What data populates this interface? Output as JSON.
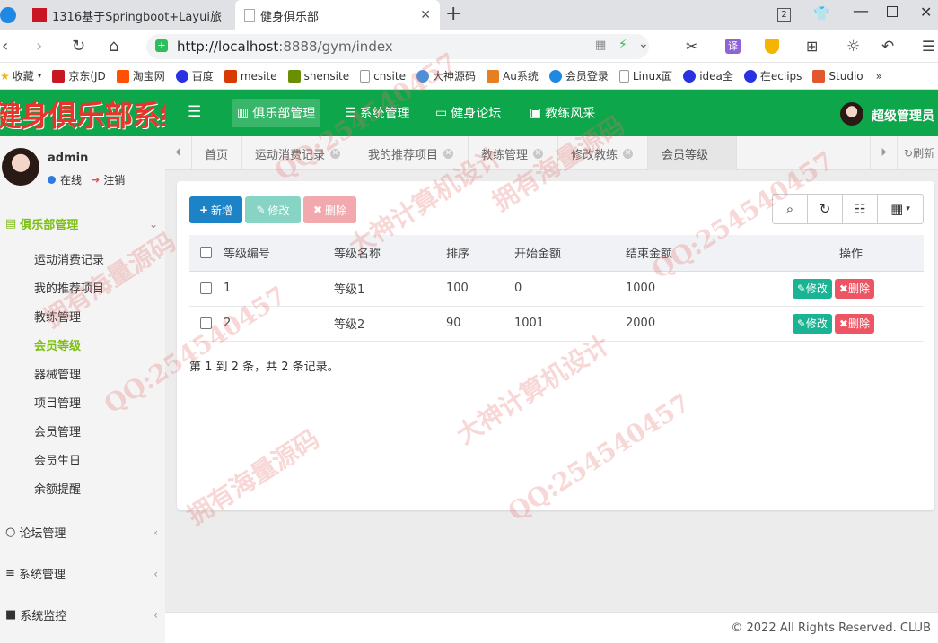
{
  "browser": {
    "tabs": [
      {
        "title": "1316基于Springboot+Layui旅"
      },
      {
        "title": "健身俱乐部"
      }
    ],
    "new_tab": "+",
    "window_badge": "2",
    "url_host": "http://localhost",
    "url_rest": ":8888/gym/index",
    "bookmarks": [
      {
        "label": "收藏",
        "color": "#f5b400"
      },
      {
        "label": "京东(JD",
        "color": "#c81623"
      },
      {
        "label": "淘宝网",
        "color": "#ff5000"
      },
      {
        "label": "百度",
        "color": "#2932e1"
      },
      {
        "label": "mesite",
        "color": "#d83b01"
      },
      {
        "label": "shensite",
        "color": "#6a8f00"
      },
      {
        "label": "cnsite",
        "color": "#888888"
      },
      {
        "label": "大神源码",
        "color": "#4a90d9"
      },
      {
        "label": "Au系统",
        "color": "#e67e22"
      },
      {
        "label": "会员登录",
        "color": "#1e88e5"
      },
      {
        "label": "Linux面",
        "color": "#888888"
      },
      {
        "label": "idea全",
        "color": "#2932e1"
      },
      {
        "label": "在eclips",
        "color": "#2932e1"
      },
      {
        "label": "Studio",
        "color": "#e4572e"
      }
    ]
  },
  "app": {
    "logo_text": "健身俱乐部系统",
    "header_nav": [
      {
        "label": "俱乐部管理",
        "icon": "bar-chart-icon",
        "active": true
      },
      {
        "label": "系统管理",
        "icon": "list-icon",
        "active": false
      },
      {
        "label": "健身论坛",
        "icon": "keyboard-icon",
        "active": false
      },
      {
        "label": "教练风采",
        "icon": "image-icon",
        "active": false
      }
    ],
    "user_name": "超级管理员",
    "accent": "#0ea64a"
  },
  "sidebar": {
    "user": "admin",
    "status_online": "在线",
    "logout": "注销",
    "group_active": "俱乐部管理",
    "items": [
      {
        "label": "运动消费记录"
      },
      {
        "label": "我的推荐项目"
      },
      {
        "label": "教练管理"
      },
      {
        "label": "会员等级",
        "active": true
      },
      {
        "label": "器械管理"
      },
      {
        "label": "项目管理"
      },
      {
        "label": "会员管理"
      },
      {
        "label": "会员生日"
      },
      {
        "label": "余额提醒"
      }
    ],
    "groups": [
      {
        "label": "论坛管理"
      },
      {
        "label": "系统管理"
      },
      {
        "label": "系统监控"
      }
    ]
  },
  "page_tabs": {
    "items": [
      {
        "label": "首页",
        "closable": false
      },
      {
        "label": "运动消费记录",
        "closable": true
      },
      {
        "label": "我的推荐项目",
        "closable": true
      },
      {
        "label": "教练管理",
        "closable": true
      },
      {
        "label": "修改教练",
        "closable": true
      },
      {
        "label": "会员等级",
        "closable": false,
        "active": true
      }
    ],
    "refresh": "刷新"
  },
  "toolbar": {
    "add": "新增",
    "edit": "修改",
    "delete": "删除"
  },
  "table": {
    "headers": [
      "等级编号",
      "等级名称",
      "排序",
      "开始金额",
      "结束金额",
      "操作"
    ],
    "rows": [
      {
        "id": "1",
        "name": "等级1",
        "sort": "100",
        "start": "0",
        "end": "1000"
      },
      {
        "id": "2",
        "name": "等级2",
        "sort": "90",
        "start": "1001",
        "end": "2000"
      }
    ],
    "row_edit": "修改",
    "row_delete": "删除",
    "pagination": "第 1 到 2 条，共 2 条记录。"
  },
  "footer": {
    "text": "© 2022 All Rights Reserved. CLUB"
  },
  "watermarks": [
    "QQ:254540457",
    "大神计算机设计",
    "拥有海量源码"
  ]
}
